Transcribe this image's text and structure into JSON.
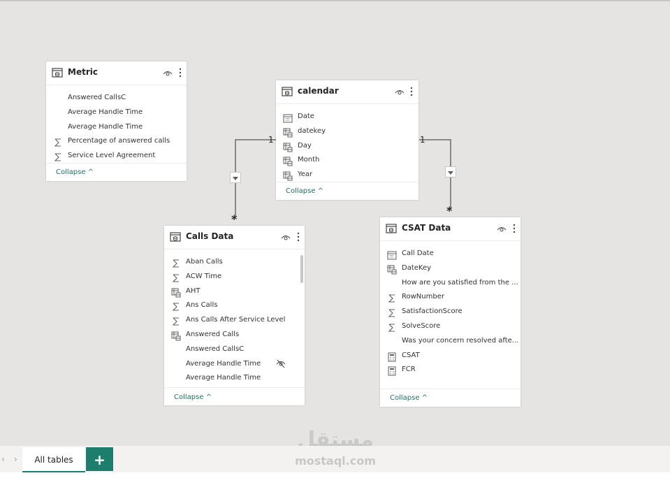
{
  "tables": {
    "metric": {
      "title": "Metric",
      "fields": [
        {
          "name": "Answered CallsC",
          "icon": "none"
        },
        {
          "name": "Average Handle Time",
          "icon": "none"
        },
        {
          "name": "Average Handle Time",
          "icon": "none"
        },
        {
          "name": "Percentage of answered calls",
          "icon": "sigma-icon"
        },
        {
          "name": "Service Level Agreement",
          "icon": "sigma-icon"
        }
      ],
      "collapse": "Collapse ^"
    },
    "calendar": {
      "title": "calendar",
      "fields": [
        {
          "name": "Date",
          "icon": "calendar-icon"
        },
        {
          "name": "datekey",
          "icon": "hierarchy-table-icon"
        },
        {
          "name": "Day",
          "icon": "hierarchy-table-icon"
        },
        {
          "name": "Month",
          "icon": "hierarchy-table-icon"
        },
        {
          "name": "Year",
          "icon": "hierarchy-table-icon"
        }
      ],
      "collapse": "Collapse ^"
    },
    "calls": {
      "title": "Calls Data",
      "fields": [
        {
          "name": "Aban Calls",
          "icon": "sigma-icon"
        },
        {
          "name": "ACW Time",
          "icon": "sigma-icon"
        },
        {
          "name": "AHT",
          "icon": "hierarchy-table-icon"
        },
        {
          "name": "Ans Calls",
          "icon": "sigma-icon"
        },
        {
          "name": "Ans Calls After Service Level",
          "icon": "sigma-icon"
        },
        {
          "name": "Answered Calls",
          "icon": "hierarchy-table-icon"
        },
        {
          "name": "Answered CallsC",
          "icon": "none"
        },
        {
          "name": "Average Handle Time",
          "icon": "none"
        },
        {
          "name": "Average Handle Time",
          "icon": "none"
        }
      ],
      "collapse": "Collapse ^"
    },
    "csat": {
      "title": "CSAT Data",
      "fields": [
        {
          "name": "Call Date",
          "icon": "calendar-icon"
        },
        {
          "name": "DateKey",
          "icon": "hierarchy-table-icon"
        },
        {
          "name": "How are you satisfied from the ...",
          "icon": "none"
        },
        {
          "name": "RowNumber",
          "icon": "sigma-icon"
        },
        {
          "name": "SatisfactionScore",
          "icon": "sigma-icon"
        },
        {
          "name": "SolveScore",
          "icon": "sigma-icon"
        },
        {
          "name": "Was your concern resolved afte...",
          "icon": "none"
        },
        {
          "name": "CSAT",
          "icon": "calculator-icon"
        },
        {
          "name": "FCR",
          "icon": "calculator-icon"
        }
      ],
      "collapse": "Collapse ^"
    }
  },
  "relationships": {
    "one": "1",
    "many": "*"
  },
  "bottom": {
    "tab_label": "All tables",
    "add_label": "+",
    "prev": "‹",
    "next": "›"
  },
  "watermark": {
    "logo": "مستقل",
    "text": "mostaql.com"
  },
  "colors": {
    "accent": "#1d7e6e",
    "canvas": "#e5e4e2"
  }
}
